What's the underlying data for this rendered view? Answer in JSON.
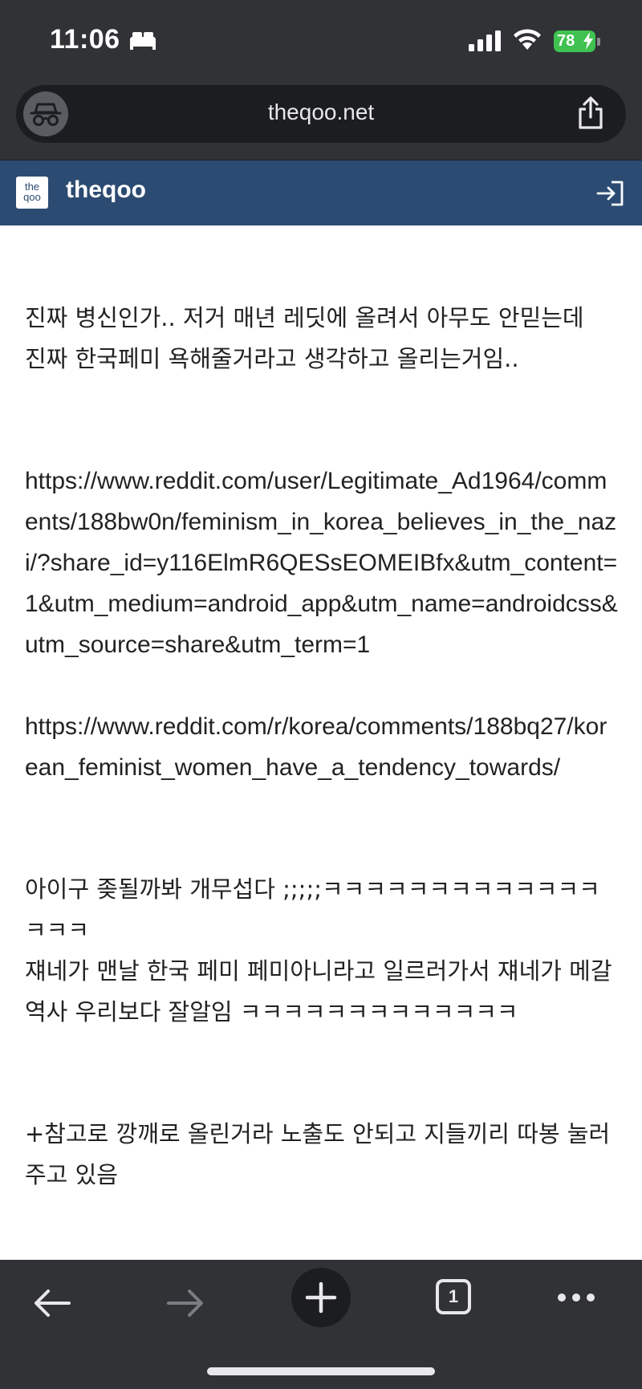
{
  "status_bar": {
    "time": "11:06",
    "battery": "78"
  },
  "browser": {
    "url": "theqoo.net"
  },
  "site": {
    "logo_text": "the qoo",
    "name": "theqoo"
  },
  "article": {
    "paragraphs": [
      "진짜 병신인가.. 저거 매년 레딧에 올려서 아무도 안믿는데\n진짜 한국페미 욕해줄거라고 생각하고 올리는거임..",
      "https://www.reddit.com/user/Legitimate_Ad1964/comments/188bw0n/feminism_in_korea_believes_in_the_nazi/?share_id=y116ElmR6QESsEOMEIBfx&utm_content=1&utm_medium=android_app&utm_name=androidcss&utm_source=share&utm_term=1",
      "https://www.reddit.com/r/korea/comments/188bq27/korean_feminist_women_have_a_tendency_towards/",
      "아이구 좆될까봐 개무섭다 ;;;;;ㅋㅋㅋㅋㅋㅋㅋㅋㅋㅋㅋㅋㅋㅋㅋㅋ\n쟤네가 맨날 한국 페미 페미아니라고 일르러가서 쟤네가 메갈 역사 우리보다 잘알임 ㅋㅋㅋㅋㅋㅋㅋㅋㅋㅋㅋㅋㅋ",
      "+참고로 깡깨로 올린거라 노출도 안되고 지들끼리 따봉 눌러주고 있음"
    ]
  },
  "toolbar": {
    "tab_count": "1"
  },
  "icons": {
    "sleep": "bed-icon",
    "signal": "cellular-signal-icon",
    "wifi": "wifi-icon",
    "incognito": "incognito-icon",
    "share": "share-icon",
    "login": "login-icon",
    "back": "back-arrow-icon",
    "forward": "forward-arrow-icon",
    "new_tab": "plus-icon",
    "more": "more-dots-icon"
  },
  "colors": {
    "chrome_bg": "#303236",
    "site_header_bg": "#2c4b72",
    "battery_green": "#3fc24f"
  }
}
